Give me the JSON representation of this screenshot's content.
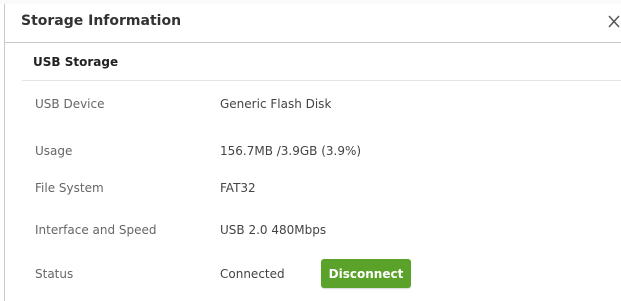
{
  "dialog": {
    "title": "Storage Information",
    "close_icon": "close-icon"
  },
  "section": {
    "title": "USB Storage"
  },
  "rows": [
    {
      "label": "USB Device",
      "value": "Generic Flash Disk"
    },
    {
      "label": "Usage",
      "value": "156.7MB /3.9GB (3.9%)"
    },
    {
      "label": "File System",
      "value": "FAT32"
    },
    {
      "label": "Interface and Speed",
      "value": "USB 2.0 480Mbps"
    },
    {
      "label": "Status",
      "value": "Connected"
    }
  ],
  "actions": {
    "disconnect_label": "Disconnect"
  },
  "colors": {
    "accent": "#5aa22a",
    "border": "#c8c8c8"
  }
}
